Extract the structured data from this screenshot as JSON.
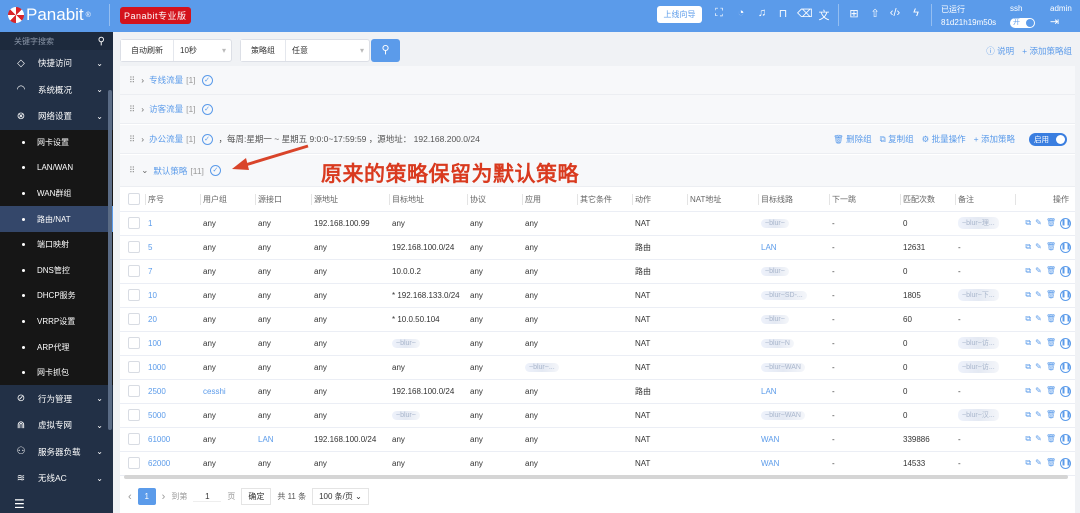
{
  "header": {
    "logo": "Panabit",
    "edition_badge": "Panabit专业版",
    "wizard_button": "上线向导",
    "uptime_label": "已运行",
    "uptime_value": "81d21h19m50s",
    "ssh_label": "ssh",
    "ssh_toggle": "开",
    "user": "admin"
  },
  "sidebar": {
    "search_placeholder": "关键字搜索",
    "items_top": [
      {
        "label": "快捷访问",
        "icon": "diamond-icon"
      },
      {
        "label": "系统概况",
        "icon": "gauge-icon"
      },
      {
        "label": "网络设置",
        "icon": "network-icon"
      }
    ],
    "sub_items": [
      "网卡设置",
      "LAN/WAN",
      "WAN群组",
      "路由/NAT",
      "端口映射",
      "DNS管控",
      "DHCP服务",
      "VRRP设置",
      "ARP代理",
      "网卡抓包"
    ],
    "active_sub": "路由/NAT",
    "items_bottom": [
      {
        "label": "行为管理",
        "icon": "behavior-icon"
      },
      {
        "label": "虚拟专网",
        "icon": "vpn-icon"
      },
      {
        "label": "服务器负载",
        "icon": "server-load-icon"
      },
      {
        "label": "无线AC",
        "icon": "wifi-icon"
      }
    ]
  },
  "toolbar": {
    "auto_refresh_label": "自动刷新",
    "auto_refresh_value": "10秒",
    "policy_group_label": "策略组",
    "policy_group_value": "任意",
    "help": "说明",
    "add_group": "添加策略组"
  },
  "groups": [
    {
      "name": "专线流量",
      "count": "[1]"
    },
    {
      "name": "访客流量",
      "count": "[1]"
    },
    {
      "name": "办公流量",
      "count": "[1]",
      "desc": "，每周:星期一 ~ 星期五 9:0:0~17:59:59 ，源地址：  192.168.200.0/24",
      "actions": [
        "删除组",
        "复制组",
        "批量操作",
        "添加策略"
      ],
      "toggle": "启用"
    },
    {
      "name": "默认策略",
      "count": "[11]"
    }
  ],
  "annotation": "原来的策略保留为默认策略",
  "table": {
    "columns": [
      "序号",
      "用户组",
      "源接口",
      "源地址",
      "目标地址",
      "协议",
      "应用",
      "其它条件",
      "动作",
      "NAT地址",
      "目标线路",
      "下一跳",
      "匹配次数",
      "备注",
      "操作"
    ],
    "rows": [
      {
        "id": "1",
        "user": "any",
        "iface": "any",
        "src": "192.168.100.99",
        "dst": "any",
        "proto": "any",
        "app": "any",
        "other": "",
        "action": "NAT",
        "nat": "",
        "line": "~blur~",
        "next": "-",
        "hits": "0",
        "remark": "~blur~理..."
      },
      {
        "id": "5",
        "user": "any",
        "iface": "any",
        "src": "any",
        "dst": "192.168.100.0/24",
        "proto": "any",
        "app": "any",
        "other": "",
        "action": "路由",
        "nat": "",
        "line": "LAN",
        "next": "-",
        "hits": "12631",
        "remark": "-"
      },
      {
        "id": "7",
        "user": "any",
        "iface": "any",
        "src": "any",
        "dst": "10.0.0.2",
        "proto": "any",
        "app": "any",
        "other": "",
        "action": "路由",
        "nat": "",
        "line": "~blur~",
        "next": "-",
        "hits": "0",
        "remark": "-"
      },
      {
        "id": "10",
        "user": "any",
        "iface": "any",
        "src": "any",
        "dst": "*  192.168.133.0/24",
        "proto": "any",
        "app": "any",
        "other": "",
        "action": "NAT",
        "nat": "",
        "line": "~blur~SD-...",
        "next": "-",
        "hits": "1805",
        "remark": "~blur~下..."
      },
      {
        "id": "20",
        "user": "any",
        "iface": "any",
        "src": "any",
        "dst": "*  10.0.50.104",
        "proto": "any",
        "app": "any",
        "other": "",
        "action": "NAT",
        "nat": "",
        "line": "~blur~",
        "next": "-",
        "hits": "60",
        "remark": "-"
      },
      {
        "id": "100",
        "user": "any",
        "iface": "any",
        "src": "any",
        "dst": "~blur~",
        "proto": "any",
        "app": "any",
        "other": "",
        "action": "NAT",
        "nat": "",
        "line": "~blur~N",
        "next": "-",
        "hits": "0",
        "remark": "~blur~访..."
      },
      {
        "id": "1000",
        "user": "any",
        "iface": "any",
        "src": "any",
        "dst": "any",
        "proto": "any",
        "app": "~blur~...",
        "other": "",
        "action": "NAT",
        "nat": "",
        "line": "~blur~WAN",
        "next": "-",
        "hits": "0",
        "remark": "~blur~访..."
      },
      {
        "id": "2500",
        "user": "cesshi",
        "iface": "any",
        "src": "any",
        "dst": "192.168.100.0/24",
        "proto": "any",
        "app": "any",
        "other": "",
        "action": "路由",
        "nat": "",
        "line": "LAN",
        "next": "-",
        "hits": "0",
        "remark": "-"
      },
      {
        "id": "5000",
        "user": "any",
        "iface": "any",
        "src": "any",
        "dst": "~blur~",
        "proto": "any",
        "app": "any",
        "other": "",
        "action": "NAT",
        "nat": "",
        "line": "~blur~WAN",
        "next": "-",
        "hits": "0",
        "remark": "~blur~汉..."
      },
      {
        "id": "61000",
        "user": "any",
        "iface": "LAN",
        "src": "192.168.100.0/24",
        "dst": "any",
        "proto": "any",
        "app": "any",
        "other": "",
        "action": "NAT",
        "nat": "",
        "line": "WAN",
        "next": "-",
        "hits": "339886",
        "remark": "-"
      },
      {
        "id": "62000",
        "user": "any",
        "iface": "any",
        "src": "any",
        "dst": "any",
        "proto": "any",
        "app": "any",
        "other": "",
        "action": "NAT",
        "nat": "",
        "line": "WAN",
        "next": "-",
        "hits": "14533",
        "remark": "-"
      }
    ]
  },
  "pagination": {
    "current": "1",
    "goto_label": "到第",
    "goto_value": "1",
    "page_unit": "页",
    "confirm": "确定",
    "total": "共 11 条",
    "page_size": "100 条/页"
  }
}
